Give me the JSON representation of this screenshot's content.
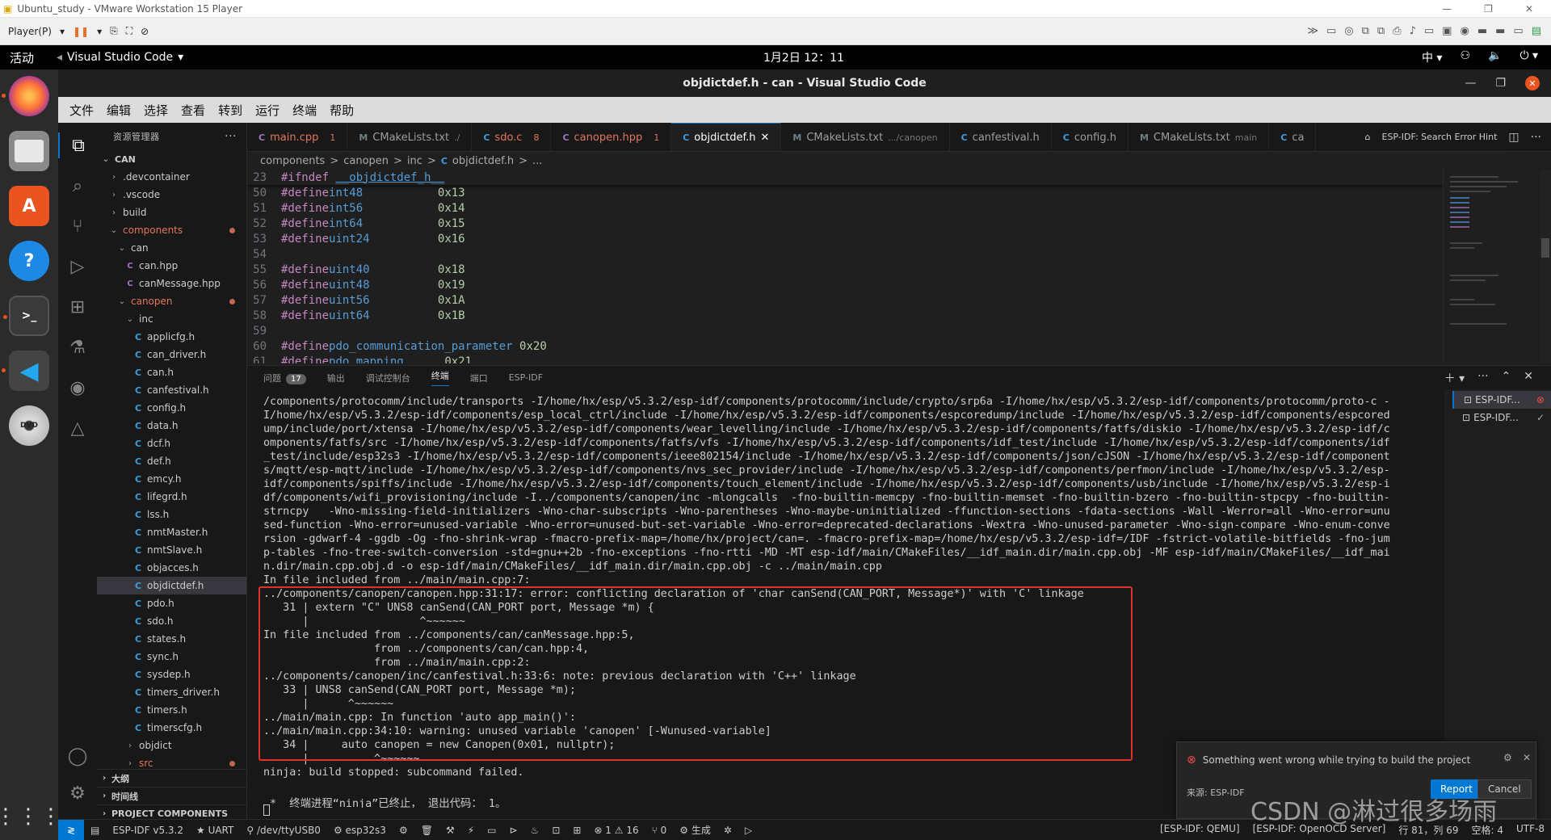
{
  "vm": {
    "title": "Ubuntu_study - VMware Workstation 15 Player",
    "player_menu": "Player(P)"
  },
  "gnome": {
    "activities": "活动",
    "app": "Visual Studio Code",
    "clock": "1月2日  12：11",
    "ime": "中"
  },
  "window": {
    "title": "objdictdef.h - can - Visual Studio Code"
  },
  "menu": [
    "文件",
    "编辑",
    "选择",
    "查看",
    "转到",
    "运行",
    "终端",
    "帮助"
  ],
  "explorer": {
    "title": "资源管理器",
    "root": "CAN",
    "items": [
      {
        "label": ".devcontainer",
        "kind": "folder",
        "depth": 1,
        "open": false
      },
      {
        "label": ".vscode",
        "kind": "folder",
        "depth": 1,
        "open": false
      },
      {
        "label": "build",
        "kind": "folder",
        "depth": 1,
        "open": false
      },
      {
        "label": "components",
        "kind": "folder",
        "depth": 1,
        "open": true,
        "mod": true
      },
      {
        "label": "can",
        "kind": "folder",
        "depth": 2,
        "open": true
      },
      {
        "label": "can.hpp",
        "kind": "hpp",
        "depth": 3
      },
      {
        "label": "canMessage.hpp",
        "kind": "hpp",
        "depth": 3
      },
      {
        "label": "canopen",
        "kind": "folder",
        "depth": 2,
        "open": true,
        "mod": true
      },
      {
        "label": "inc",
        "kind": "folder",
        "depth": 3,
        "open": true
      },
      {
        "label": "applicfg.h",
        "kind": "c",
        "depth": 4
      },
      {
        "label": "can_driver.h",
        "kind": "c",
        "depth": 4
      },
      {
        "label": "can.h",
        "kind": "c",
        "depth": 4
      },
      {
        "label": "canfestival.h",
        "kind": "c",
        "depth": 4
      },
      {
        "label": "config.h",
        "kind": "c",
        "depth": 4
      },
      {
        "label": "data.h",
        "kind": "c",
        "depth": 4
      },
      {
        "label": "dcf.h",
        "kind": "c",
        "depth": 4
      },
      {
        "label": "def.h",
        "kind": "c",
        "depth": 4
      },
      {
        "label": "emcy.h",
        "kind": "c",
        "depth": 4
      },
      {
        "label": "lifegrd.h",
        "kind": "c",
        "depth": 4
      },
      {
        "label": "lss.h",
        "kind": "c",
        "depth": 4
      },
      {
        "label": "nmtMaster.h",
        "kind": "c",
        "depth": 4
      },
      {
        "label": "nmtSlave.h",
        "kind": "c",
        "depth": 4
      },
      {
        "label": "objacces.h",
        "kind": "c",
        "depth": 4
      },
      {
        "label": "objdictdef.h",
        "kind": "c",
        "depth": 4,
        "sel": true
      },
      {
        "label": "pdo.h",
        "kind": "c",
        "depth": 4
      },
      {
        "label": "sdo.h",
        "kind": "c",
        "depth": 4
      },
      {
        "label": "states.h",
        "kind": "c",
        "depth": 4
      },
      {
        "label": "sync.h",
        "kind": "c",
        "depth": 4
      },
      {
        "label": "sysdep.h",
        "kind": "c",
        "depth": 4
      },
      {
        "label": "timers_driver.h",
        "kind": "c",
        "depth": 4
      },
      {
        "label": "timers.h",
        "kind": "c",
        "depth": 4
      },
      {
        "label": "timerscfg.h",
        "kind": "c",
        "depth": 4
      },
      {
        "label": "objdict",
        "kind": "folder",
        "depth": 3,
        "open": false
      },
      {
        "label": "src",
        "kind": "folder",
        "depth": 3,
        "open": false,
        "mod": true
      }
    ],
    "sections": [
      "大纲",
      "时间线",
      "PROJECT COMPONENTS"
    ]
  },
  "tabs": [
    {
      "label": "main.cpp",
      "icon": "C",
      "kind": "p",
      "err": true,
      "count": "1"
    },
    {
      "label": "CMakeLists.txt",
      "icon": "M",
      "kind": "m",
      "err": false,
      "suffix": "./"
    },
    {
      "label": "sdo.c",
      "icon": "C",
      "kind": "c",
      "err": true,
      "count": "8"
    },
    {
      "label": "canopen.hpp",
      "icon": "C",
      "kind": "p",
      "err": true,
      "count": "1"
    },
    {
      "label": "objdictdef.h",
      "icon": "C",
      "kind": "c",
      "active": true
    },
    {
      "label": "CMakeLists.txt",
      "icon": "M",
      "kind": "m",
      "suffix": ".../canopen"
    },
    {
      "label": "canfestival.h",
      "icon": "C",
      "kind": "c"
    },
    {
      "label": "config.h",
      "icon": "C",
      "kind": "c"
    },
    {
      "label": "CMakeLists.txt",
      "icon": "M",
      "kind": "m",
      "suffix": "main"
    },
    {
      "label": "ca",
      "icon": "C",
      "kind": "c"
    }
  ],
  "tab_right": "ESP-IDF: Search Error Hint",
  "breadcrumb": [
    "components",
    ">",
    "canopen",
    ">",
    "inc",
    ">",
    "C",
    "objdictdef.h",
    ">",
    "..."
  ],
  "sticky": {
    "ln": "23",
    "kw": "#ifndef",
    "name": "__objdictdef_h__"
  },
  "code": [
    {
      "ln": "50",
      "kw": "#define",
      "name": "int48",
      "pad": "           ",
      "val": "0x13"
    },
    {
      "ln": "51",
      "kw": "#define",
      "name": "int56",
      "pad": "           ",
      "val": "0x14"
    },
    {
      "ln": "52",
      "kw": "#define",
      "name": "int64",
      "pad": "           ",
      "val": "0x15"
    },
    {
      "ln": "53",
      "kw": "#define",
      "name": "uint24",
      "pad": "          ",
      "val": "0x16"
    },
    {
      "ln": "54",
      "kw": "",
      "name": "",
      "pad": "",
      "val": ""
    },
    {
      "ln": "55",
      "kw": "#define",
      "name": "uint40",
      "pad": "          ",
      "val": "0x18"
    },
    {
      "ln": "56",
      "kw": "#define",
      "name": "uint48",
      "pad": "          ",
      "val": "0x19"
    },
    {
      "ln": "57",
      "kw": "#define",
      "name": "uint56",
      "pad": "          ",
      "val": "0x1A"
    },
    {
      "ln": "58",
      "kw": "#define",
      "name": "uint64",
      "pad": "          ",
      "val": "0x1B"
    },
    {
      "ln": "59",
      "kw": "",
      "name": "",
      "pad": "",
      "val": ""
    },
    {
      "ln": "60",
      "kw": "#define",
      "name": "pdo_communication_parameter",
      "pad": " ",
      "val": "0x20"
    },
    {
      "ln": "61",
      "kw": "#define",
      "name": "pdo_mapping",
      "pad": "      ",
      "val": "0x21"
    }
  ],
  "panel_tabs": [
    {
      "label": "问题",
      "badge": "17"
    },
    {
      "label": "输出"
    },
    {
      "label": "调试控制台"
    },
    {
      "label": "终端",
      "active": true
    },
    {
      "label": "端口"
    },
    {
      "label": "ESP-IDF"
    }
  ],
  "terminal_lines": [
    "/components/protocomm/include/transports -I/home/hx/esp/v5.3.2/esp-idf/components/protocomm/include/crypto/srp6a -I/home/hx/esp/v5.3.2/esp-idf/components/protocomm/proto-c -",
    "I/home/hx/esp/v5.3.2/esp-idf/components/esp_local_ctrl/include -I/home/hx/esp/v5.3.2/esp-idf/components/espcoredump/include -I/home/hx/esp/v5.3.2/esp-idf/components/espcored",
    "ump/include/port/xtensa -I/home/hx/esp/v5.3.2/esp-idf/components/wear_levelling/include -I/home/hx/esp/v5.3.2/esp-idf/components/fatfs/diskio -I/home/hx/esp/v5.3.2/esp-idf/c",
    "omponents/fatfs/src -I/home/hx/esp/v5.3.2/esp-idf/components/fatfs/vfs -I/home/hx/esp/v5.3.2/esp-idf/components/idf_test/include -I/home/hx/esp/v5.3.2/esp-idf/components/idf",
    "_test/include/esp32s3 -I/home/hx/esp/v5.3.2/esp-idf/components/ieee802154/include -I/home/hx/esp/v5.3.2/esp-idf/components/json/cJSON -I/home/hx/esp/v5.3.2/esp-idf/component",
    "s/mqtt/esp-mqtt/include -I/home/hx/esp/v5.3.2/esp-idf/components/nvs_sec_provider/include -I/home/hx/esp/v5.3.2/esp-idf/components/perfmon/include -I/home/hx/esp/v5.3.2/esp-",
    "idf/components/spiffs/include -I/home/hx/esp/v5.3.2/esp-idf/components/touch_element/include -I/home/hx/esp/v5.3.2/esp-idf/components/usb/include -I/home/hx/esp/v5.3.2/esp-i",
    "df/components/wifi_provisioning/include -I../components/canopen/inc -mlongcalls  -fno-builtin-memcpy -fno-builtin-memset -fno-builtin-bzero -fno-builtin-stpcpy -fno-builtin-",
    "strncpy   -Wno-missing-field-initializers -Wno-char-subscripts -Wno-parentheses -Wno-maybe-uninitialized -ffunction-sections -fdata-sections -Wall -Werror=all -Wno-error=unu",
    "sed-function -Wno-error=unused-variable -Wno-error=unused-but-set-variable -Wno-error=deprecated-declarations -Wextra -Wno-unused-parameter -Wno-sign-compare -Wno-enum-conve",
    "rsion -gdwarf-4 -ggdb -Og -fno-shrink-wrap -fmacro-prefix-map=/home/hx/project/can=. -fmacro-prefix-map=/home/hx/esp/v5.3.2/esp-idf=/IDF -fstrict-volatile-bitfields -fno-jum",
    "p-tables -fno-tree-switch-conversion -std=gnu++2b -fno-exceptions -fno-rtti -MD -MT esp-idf/main/CMakeFiles/__idf_main.dir/main.cpp.obj -MF esp-idf/main/CMakeFiles/__idf_mai",
    "n.dir/main.cpp.obj.d -o esp-idf/main/CMakeFiles/__idf_main.dir/main.cpp.obj -c ../main/main.cpp",
    "In file included from ../main/main.cpp:7:",
    "../components/canopen/canopen.hpp:31:17: error: conflicting declaration of 'char canSend(CAN_PORT, Message*)' with 'C' linkage",
    "   31 | extern \"C\" UNS8 canSend(CAN_PORT port, Message *m) {",
    "      |                 ^~~~~~~",
    "In file included from ../components/can/canMessage.hpp:5,",
    "                 from ../components/can/can.hpp:4,",
    "                 from ../main/main.cpp:2:",
    "../components/canopen/inc/canfestival.h:33:6: note: previous declaration with 'C++' linkage",
    "   33 | UNS8 canSend(CAN_PORT port, Message *m);",
    "      |      ^~~~~~~",
    "../main/main.cpp: In function 'auto app_main()':",
    "../main/main.cpp:34:10: warning: unused variable 'canopen' [-Wunused-variable]",
    "   34 |     auto canopen = new Canopen(0x01, nullptr);",
    "      |          ^~~~~~~",
    "ninja: build stopped: subcommand failed.",
    "",
    " *  终端进程“ninja”已终止， 退出代码： 1。"
  ],
  "terminal_list": [
    {
      "label": "ESP-IDF...",
      "sel": true
    },
    {
      "label": "ESP-IDF...",
      "sel": false
    }
  ],
  "toast": {
    "message": "Something went wrong while trying to build the project",
    "source": "来源: ESP-IDF",
    "report": "Report",
    "cancel": "Cancel"
  },
  "status": {
    "left": [
      "ESP-IDF v5.3.2",
      "UART",
      "/dev/ttyUSB0",
      "esp32s3",
      "⊗ 1 ⚠ 16",
      "⑂ 0",
      "生成"
    ],
    "right": [
      "[ESP-IDF: QEMU]",
      "[ESP-IDF: OpenOCD Server]",
      "行 81，列 69",
      "空格: 4",
      "UTF-8"
    ]
  },
  "watermark": "CSDN @淋过很多场雨",
  "colors": {
    "accent": "#0078d4",
    "error": "#e0302a",
    "ubuntu": "#e95420"
  }
}
